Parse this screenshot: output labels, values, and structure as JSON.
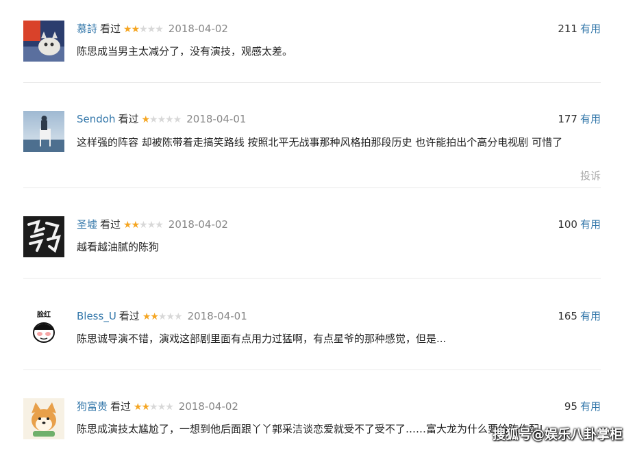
{
  "watermark": "搜狐号@娱乐八卦掌柜",
  "reviews": [
    {
      "name": "慕詩",
      "watched": "看过",
      "rating": 2,
      "date": "2018-04-02",
      "votes": "211",
      "useful": "有用",
      "text": "陈思成当男主太减分了，没有演技，观感太差。",
      "avatar_icon": "cat-photo-avatar"
    },
    {
      "name": "Sendoh",
      "watched": "看过",
      "rating": 1,
      "date": "2018-04-01",
      "votes": "177",
      "useful": "有用",
      "text": "这样强的阵容 却被陈带着走搞笑路线 按照北平无战事那种风格拍那段历史 也许能拍出个高分电视剧 可惜了",
      "report": "投诉",
      "avatar_icon": "person-on-chair-avatar"
    },
    {
      "name": "圣墟",
      "watched": "看过",
      "rating": 2,
      "date": "2018-04-02",
      "votes": "100",
      "useful": "有用",
      "text": "越看越油腻的陈狗",
      "avatar_icon": "calligraphy-avatar"
    },
    {
      "name": "Bless_U",
      "watched": "看过",
      "rating": 2,
      "date": "2018-04-01",
      "votes": "165",
      "useful": "有用",
      "text": "陈思诚导演不错，演戏这部剧里面有点用力过猛啊，有点星爷的那种感觉，但是...",
      "avatar_label": "脸红",
      "avatar_icon": "cartoon-face-avatar"
    },
    {
      "name": "狗富贵",
      "watched": "看过",
      "rating": 2,
      "date": "2018-04-02",
      "votes": "95",
      "useful": "有用",
      "text": "陈思成演技太尴尬了，一想到他后面跟丫丫郭采洁谈恋爱就受不了受不了……富大龙为什么要给陈作配!",
      "avatar_icon": "shiba-dog-avatar"
    }
  ]
}
